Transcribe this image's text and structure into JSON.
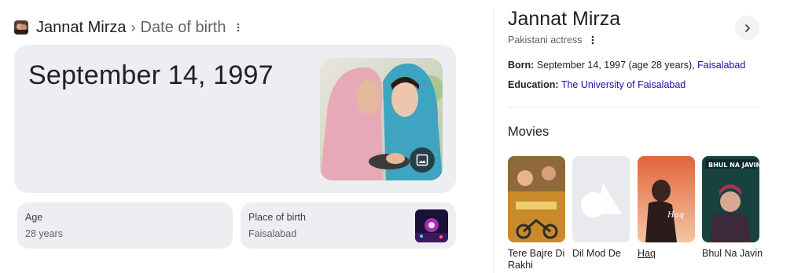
{
  "breadcrumb": {
    "entity": "Jannat Mirza",
    "separator": "›",
    "attribute": "Date of birth",
    "more_icon": "more-vert-icon"
  },
  "answer": {
    "date": "September 14, 1997",
    "photo_button_icon": "image-icon"
  },
  "cards": {
    "age": {
      "label": "Age",
      "value": "28 years"
    },
    "place_of_birth": {
      "label": "Place of birth",
      "value": "Faisalabad"
    }
  },
  "knowledge_panel": {
    "title": "Jannat Mirza",
    "subtitle": "Pakistani actress",
    "next_icon": "chevron-right-icon",
    "born": {
      "label": "Born:",
      "value": "September 14, 1997 (age 28 years),",
      "place": "Faisalabad"
    },
    "education": {
      "label": "Education:",
      "value": "The University of Faisalabad"
    },
    "movies_heading": "Movies",
    "movies": [
      {
        "title": "Tere Bajre Di Rakhi"
      },
      {
        "title": "Dil Mod De"
      },
      {
        "title": "Haq"
      },
      {
        "title": "Bhul Na Javin"
      }
    ]
  },
  "colors": {
    "card_bg": "#eceef1",
    "link": "#1a0dab",
    "text_primary": "#202124",
    "text_secondary": "#5f6368"
  }
}
